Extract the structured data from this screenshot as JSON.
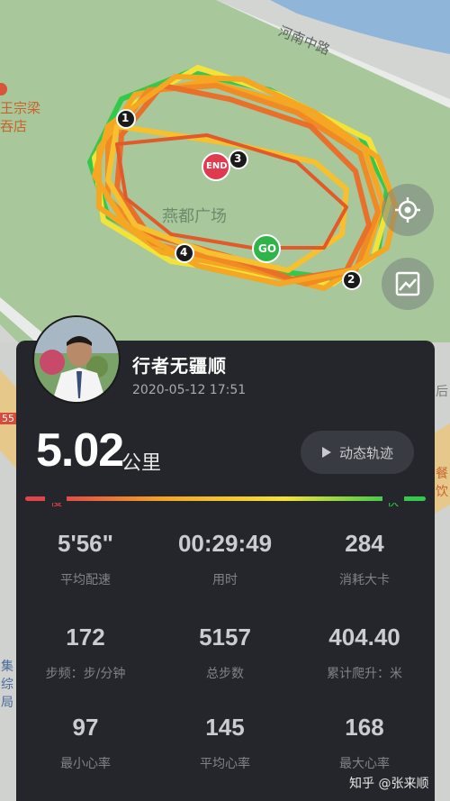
{
  "map": {
    "road_label": "河南中路",
    "park_label": "燕都广场",
    "poi_label_line1": "王宗梁",
    "poi_label_line2": "吞店",
    "poi_side_55": "55",
    "poi_side_right_a": "后",
    "poi_side_right_b": "餐饮",
    "poi_side_left": "集\n综\n局",
    "markers": {
      "start": "GO",
      "end": "END",
      "km": [
        "1",
        "2",
        "3",
        "4"
      ]
    },
    "buttons": [
      "locate-icon",
      "image-icon"
    ]
  },
  "user": {
    "name": "行者无疆顺",
    "datetime": "2020-05-12 17:51"
  },
  "distance": {
    "value": "5.02",
    "unit": "公里"
  },
  "replay_button": {
    "label": "动态轨迹",
    "icon": "play-icon"
  },
  "pace_legend": {
    "slow": "慢",
    "fast": "快",
    "colors": [
      "#e0454a",
      "#f5a623",
      "#f2e23a",
      "#33c94a"
    ]
  },
  "stats": [
    {
      "value": "5'56\"",
      "label": "平均配速"
    },
    {
      "value": "00:29:49",
      "label": "用时"
    },
    {
      "value": "284",
      "label": "消耗大卡"
    },
    {
      "value": "172",
      "label": "步频：步/分钟"
    },
    {
      "value": "5157",
      "label": "总步数"
    },
    {
      "value": "404.40",
      "label": "累计爬升：米"
    },
    {
      "value": "97",
      "label": "最小心率"
    },
    {
      "value": "145",
      "label": "平均心率"
    },
    {
      "value": "168",
      "label": "最大心率"
    }
  ],
  "watermark": "知乎 @张来顺"
}
